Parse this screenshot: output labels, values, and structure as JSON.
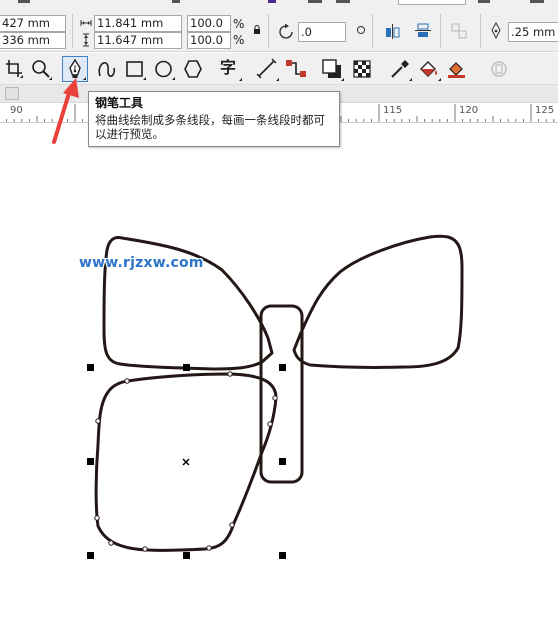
{
  "property_bar": {
    "pos_x": "427 mm",
    "pos_y": "336 mm",
    "width": "11.841 mm",
    "height": "11.647 mm",
    "scale_x": "100.0",
    "scale_y": "100.0",
    "percent": "%",
    "rotation": ".0",
    "outline_width": ".25 mm"
  },
  "toolbox": {
    "text_tool_glyph": "字",
    "active_tool": "pen-tool"
  },
  "ruler": {
    "labels": [
      "90",
      "115",
      "120",
      "125"
    ]
  },
  "tooltip": {
    "title": "钢笔工具",
    "body": "将曲线绘制成多条线段，每画一条线段时都可以进行预览。"
  },
  "watermark": "www.rjzxw.com",
  "colors": {
    "accent": "#3c80c8",
    "arrow": "#e8413a",
    "outline": "#231815",
    "watermark": "#2e74c8"
  }
}
